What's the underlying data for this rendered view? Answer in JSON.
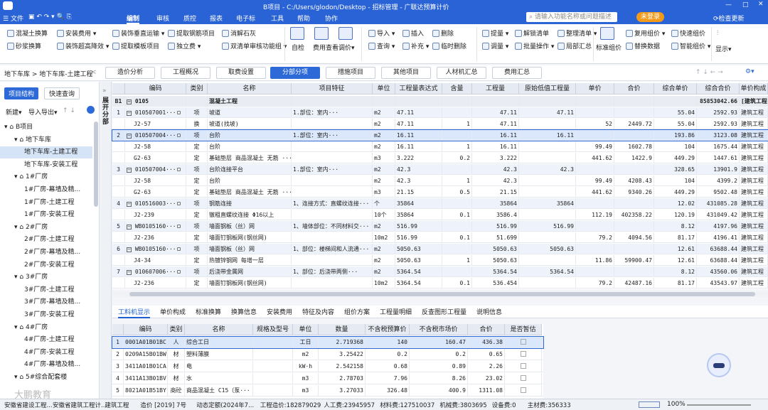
{
  "titlebar": {
    "doc_name": "B项目 - C:/Users/glodon/Desktop - 招标管理 - 广联达预算计价",
    "search_placeholder": "请输入功能名称或问题描述",
    "login_label": "未登录",
    "update_label": "检查更新"
  },
  "menu": [
    "文件",
    "编制",
    "审核",
    "质控",
    "报表",
    "电子标",
    "工具",
    "帮助",
    "协作"
  ],
  "ribbon": {
    "small_buttons": [
      "混凝土换算",
      "砂浆换算",
      "安装费用",
      "装饰超高降效",
      "装饰垂直运输",
      "提取模板项目",
      "提取钢筋项目",
      "独立费",
      "消解石灰",
      "双清单审核功能组",
      "导入",
      "查询",
      "插入",
      "补充",
      "删除",
      "临时删除",
      "提量",
      "调量",
      "解锁清单",
      "批量操作",
      "整理清单",
      "局部汇总",
      "复用组价",
      "替换数据",
      "快速组价",
      "智能组价"
    ],
    "big_buttons": [
      "自检",
      "费用查看",
      "调价",
      "标准组价",
      "显示"
    ]
  },
  "breadcrumb": "地下车库 > 地下车库-土建工程",
  "view_tabs": [
    "造价分析",
    "工程概况",
    "取费设置",
    "分部分项",
    "措施项目",
    "其他项目",
    "人材机汇总",
    "费用汇总"
  ],
  "sidebar": {
    "tab_structure": "项目结构",
    "tab_query": "快速查询",
    "new": "新建",
    "import_export": "导入导出",
    "tree": [
      {
        "label": "B项目",
        "level": 0
      },
      {
        "label": "地下车库",
        "level": 1
      },
      {
        "label": "地下车库-土建工程",
        "level": 2
      },
      {
        "label": "地下车库-安装工程",
        "level": 2
      },
      {
        "label": "1#厂房",
        "level": 1
      },
      {
        "label": "1#厂房-幕墙及精...",
        "level": 2
      },
      {
        "label": "1#厂房-土建工程",
        "level": 2
      },
      {
        "label": "1#厂房-安装工程",
        "level": 2
      },
      {
        "label": "2#厂房",
        "level": 1
      },
      {
        "label": "2#厂房-土建工程",
        "level": 2
      },
      {
        "label": "2#厂房-幕墙及精...",
        "level": 2
      },
      {
        "label": "2#厂房-安装工程",
        "level": 2
      },
      {
        "label": "3#厂房",
        "level": 1
      },
      {
        "label": "3#厂房-土建工程",
        "level": 2
      },
      {
        "label": "3#厂房-幕墙及精...",
        "level": 2
      },
      {
        "label": "3#厂房-安装工程",
        "level": 2
      },
      {
        "label": "4#厂房",
        "level": 1
      },
      {
        "label": "4#厂房-土建工程",
        "level": 2
      },
      {
        "label": "4#厂房-安装工程",
        "level": 2
      },
      {
        "label": "4#厂房-幕墙及精...",
        "level": 2
      },
      {
        "label": "5#综合配套楼",
        "level": 1
      }
    ]
  },
  "expand_label": "展开分部",
  "grid": {
    "headers": [
      "编码",
      "类别",
      "名称",
      "项目特征",
      "单位",
      "工程量表达式",
      "含量",
      "工程量",
      "原始低值工程量",
      "单价",
      "合价",
      "综合单价",
      "综合合价",
      "单价构成"
    ],
    "rows": [
      {
        "no": "B1",
        "code": "0105",
        "type": "",
        "name": "混凝土工程",
        "feat": "",
        "unit": "",
        "expr": "",
        "qty_r": "",
        "qty": "",
        "orig": "",
        "up": "",
        "tp": "",
        "cup": "",
        "ctp": "85853042.66",
        "comp": "[建筑工程]",
        "kind": "sec"
      },
      {
        "no": "1",
        "code": "010507001···",
        "type": "项",
        "name": "坡道",
        "feat": "1.部位：室内···",
        "unit": "m2",
        "expr": "47.11",
        "qty_r": "",
        "qty": "47.11",
        "orig": "47.11",
        "up": "",
        "tp": "",
        "cup": "55.04",
        "ctp": "2592.93",
        "comp": "建筑工程",
        "kind": "item"
      },
      {
        "no": "",
        "code": "J2-57",
        "type": "换",
        "name": "坡道(找坡)",
        "feat": "",
        "unit": "m2",
        "expr": "47.11",
        "qty_r": "1",
        "qty": "47.11",
        "orig": "",
        "up": "52",
        "tp": "2449.72",
        "cup": "55.04",
        "ctp": "2592.93",
        "comp": "建筑工程",
        "kind": ""
      },
      {
        "no": "2",
        "code": "010507004···",
        "type": "项",
        "name": "台阶",
        "feat": "1.部位：室内···",
        "unit": "m2",
        "expr": "16.11",
        "qty_r": "",
        "qty": "16.11",
        "orig": "16.11",
        "up": "",
        "tp": "",
        "cup": "193.86",
        "ctp": "3123.08",
        "comp": "建筑工程",
        "kind": "selrow"
      },
      {
        "no": "",
        "code": "J2-58",
        "type": "定",
        "name": "台阶",
        "feat": "",
        "unit": "m2",
        "expr": "16.11",
        "qty_r": "1",
        "qty": "16.11",
        "orig": "",
        "up": "99.49",
        "tp": "1602.78",
        "cup": "104",
        "ctp": "1675.44",
        "comp": "建筑工程",
        "kind": ""
      },
      {
        "no": "",
        "code": "G2-63",
        "type": "定",
        "name": "基础垫层 商品混凝土 无筋 ···",
        "feat": "",
        "unit": "m3",
        "expr": "3.222",
        "qty_r": "0.2",
        "qty": "3.222",
        "orig": "",
        "up": "441.62",
        "tp": "1422.9",
        "cup": "449.29",
        "ctp": "1447.61",
        "comp": "建筑工程",
        "kind": ""
      },
      {
        "no": "3",
        "code": "010507004···",
        "type": "项",
        "name": "台阶连接平台",
        "feat": "1.部位：室内···",
        "unit": "m2",
        "expr": "42.3",
        "qty_r": "",
        "qty": "42.3",
        "orig": "42.3",
        "up": "",
        "tp": "",
        "cup": "328.65",
        "ctp": "13901.9",
        "comp": "建筑工程",
        "kind": "item"
      },
      {
        "no": "",
        "code": "J2-58",
        "type": "定",
        "name": "台阶",
        "feat": "",
        "unit": "m2",
        "expr": "42.3",
        "qty_r": "1",
        "qty": "42.3",
        "orig": "",
        "up": "99.49",
        "tp": "4208.43",
        "cup": "104",
        "ctp": "4399.2",
        "comp": "建筑工程",
        "kind": ""
      },
      {
        "no": "",
        "code": "G2-63",
        "type": "定",
        "name": "基础垫层 商品混凝土 无筋 ···",
        "feat": "",
        "unit": "m3",
        "expr": "21.15",
        "qty_r": "0.5",
        "qty": "21.15",
        "orig": "",
        "up": "441.62",
        "tp": "9340.26",
        "cup": "449.29",
        "ctp": "9502.48",
        "comp": "建筑工程",
        "kind": ""
      },
      {
        "no": "4",
        "code": "010516003···",
        "type": "项",
        "name": "钢筋连接",
        "feat": "1、连接方式：直螺纹连接···",
        "unit": "个",
        "expr": "35864",
        "qty_r": "",
        "qty": "35864",
        "orig": "35864",
        "up": "",
        "tp": "",
        "cup": "12.02",
        "ctp": "431085.28",
        "comp": "建筑工程",
        "kind": "item"
      },
      {
        "no": "",
        "code": "J2-239",
        "type": "定",
        "name": "镦粗直螺纹连接 Φ16以上",
        "feat": "",
        "unit": "10个",
        "expr": "35864",
        "qty_r": "0.1",
        "qty": "3586.4",
        "orig": "",
        "up": "112.19",
        "tp": "402358.22",
        "cup": "120.19",
        "ctp": "431049.42",
        "comp": "建筑工程",
        "kind": ""
      },
      {
        "no": "5",
        "code": "WB0105160···",
        "type": "项",
        "name": "墙面钢板（丝）网",
        "feat": "1、墙体部位：不同材料交···",
        "unit": "m2",
        "expr": "516.99",
        "qty_r": "",
        "qty": "516.99",
        "orig": "516.99",
        "up": "",
        "tp": "",
        "cup": "8.12",
        "ctp": "4197.96",
        "comp": "建筑工程",
        "kind": "item"
      },
      {
        "no": "",
        "code": "J2-236",
        "type": "定",
        "name": "墙面钉钢板网(钢丝网)",
        "feat": "",
        "unit": "10m2",
        "expr": "516.99",
        "qty_r": "0.1",
        "qty": "51.699",
        "orig": "",
        "up": "79.2",
        "tp": "4094.56",
        "cup": "81.17",
        "ctp": "4196.41",
        "comp": "建筑工程",
        "kind": ""
      },
      {
        "no": "6",
        "code": "WB0105160···",
        "type": "项",
        "name": "墙面钢板（丝）网",
        "feat": "1、部位：楼梯间和人流通···",
        "unit": "m2",
        "expr": "5050.63",
        "qty_r": "",
        "qty": "5050.63",
        "orig": "5050.63",
        "up": "",
        "tp": "",
        "cup": "12.61",
        "ctp": "63688.44",
        "comp": "建筑工程",
        "kind": "item"
      },
      {
        "no": "",
        "code": "J4-34",
        "type": "定",
        "name": "热镀锌钢网 每增一层",
        "feat": "",
        "unit": "m2",
        "expr": "5050.63",
        "qty_r": "1",
        "qty": "5050.63",
        "orig": "",
        "up": "11.86",
        "tp": "59900.47",
        "cup": "12.61",
        "ctp": "63688.44",
        "comp": "建筑工程",
        "kind": ""
      },
      {
        "no": "7",
        "code": "010607006···",
        "type": "项",
        "name": "后浇带金属网",
        "feat": "1、部位：后浇带两侧···",
        "unit": "m2",
        "expr": "5364.54",
        "qty_r": "",
        "qty": "5364.54",
        "orig": "5364.54",
        "up": "",
        "tp": "",
        "cup": "8.12",
        "ctp": "43560.06",
        "comp": "建筑工程",
        "kind": "item"
      },
      {
        "no": "",
        "code": "J2-236",
        "type": "定",
        "name": "墙面钉钢板网(钢丝网)",
        "feat": "",
        "unit": "10m2",
        "expr": "5364.54",
        "qty_r": "0.1",
        "qty": "536.454",
        "orig": "",
        "up": "79.2",
        "tp": "42487.16",
        "cup": "81.17",
        "ctp": "43543.97",
        "comp": "建筑工程",
        "kind": ""
      }
    ]
  },
  "bottom_tabs": [
    "工料机显示",
    "单价构成",
    "标准换算",
    "换算信息",
    "安装费用",
    "特征及内容",
    "组价方案",
    "工程量明细",
    "反查图形工程量",
    "说明信息"
  ],
  "bottom_grid": {
    "headers": [
      "编码",
      "类别",
      "名称",
      "规格及型号",
      "单位",
      "数量",
      "不含税预算价",
      "不含税市场价",
      "合价",
      "是否暂估"
    ],
    "rows": [
      {
        "no": "1",
        "code": "0001A01B01BC",
        "type": "人",
        "name": "综合工日",
        "spec": "",
        "unit": "工日",
        "qty": "2.719368",
        "pre": "140",
        "mkt": "160.47",
        "total": "436.38"
      },
      {
        "no": "2",
        "code": "0209A15B01BW",
        "type": "材",
        "name": "塑料薄膜",
        "spec": "",
        "unit": "m2",
        "qty": "3.25422",
        "pre": "0.2",
        "mkt": "0.2",
        "total": "0.65"
      },
      {
        "no": "3",
        "code": "3411A01B01CA",
        "type": "材",
        "name": "电",
        "spec": "",
        "unit": "kW·h",
        "qty": "2.542158",
        "pre": "0.68",
        "mkt": "0.89",
        "total": "2.26"
      },
      {
        "no": "4",
        "code": "3411A13B01BV",
        "type": "材",
        "name": "水",
        "spec": "",
        "unit": "m3",
        "qty": "2.78703",
        "pre": "7.96",
        "mkt": "8.26",
        "total": "23.02"
      },
      {
        "no": "5",
        "code": "8021A01B51BY",
        "type": "商砼",
        "name": "商品混凝土 C15（泵···",
        "spec": "",
        "unit": "m3",
        "qty": "3.27033",
        "pre": "326.48",
        "mkt": "400.9",
        "total": "1311.08"
      }
    ]
  },
  "status": {
    "items": [
      "安徽省建设工程...",
      "安徽省建筑工程计...",
      "建筑工程",
      "造价 [2019] 7号",
      "动态定额(2024年7...",
      "工程造价:182879029",
      "人工费:23945957",
      "材料费:127510037",
      "机械费:3803695",
      "设备费:0",
      "主材费:356333"
    ],
    "zoom": "100%"
  },
  "watermark": "大鹏教育"
}
